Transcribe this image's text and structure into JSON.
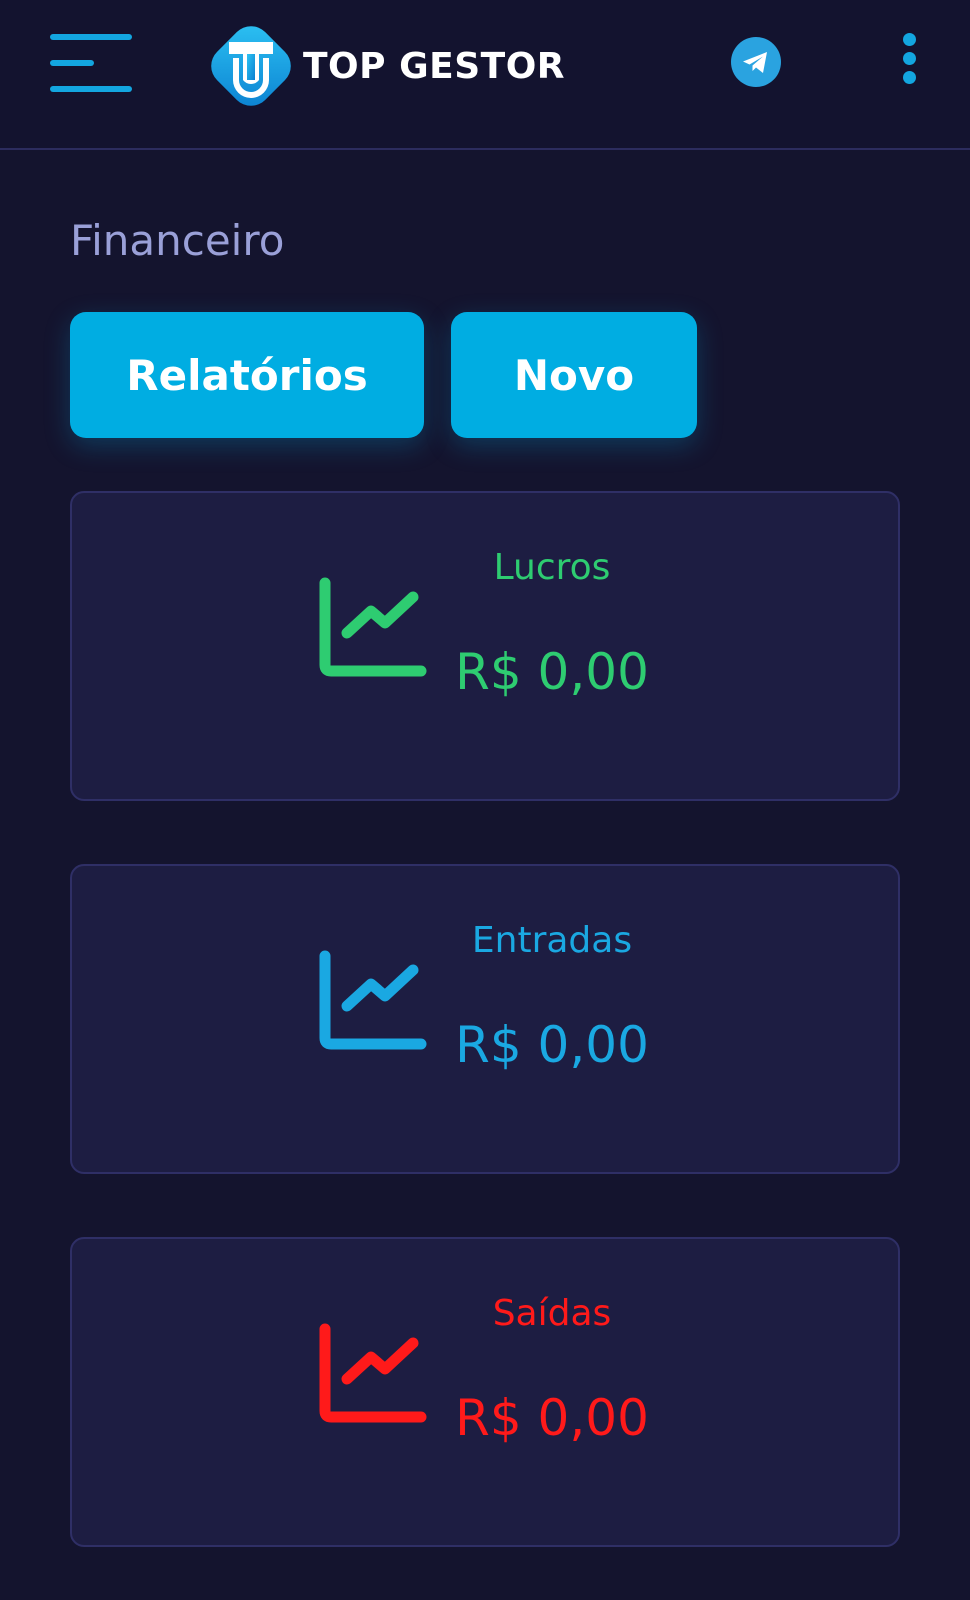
{
  "header": {
    "brand": "TOP GESTOR",
    "menu_icon": "hamburger-menu-icon",
    "telegram_icon": "telegram-icon",
    "more_icon": "more-vertical-icon"
  },
  "page": {
    "title": "Financeiro"
  },
  "actions": {
    "reports_label": "Relatórios",
    "new_label": "Novo"
  },
  "cards": [
    {
      "label": "Lucros",
      "value": "R$ 0,00",
      "color": "#2ecc71",
      "icon": "line-chart-icon"
    },
    {
      "label": "Entradas",
      "value": "R$ 0,00",
      "color": "#1aa8e2",
      "icon": "line-chart-icon"
    },
    {
      "label": "Saídas",
      "value": "R$ 0,00",
      "color": "#ff1a1a",
      "icon": "line-chart-icon"
    }
  ],
  "colors": {
    "background": "#14142e",
    "accent": "#00ade2",
    "card_bg": "#1d1d42",
    "title": "#9aa0d8"
  }
}
